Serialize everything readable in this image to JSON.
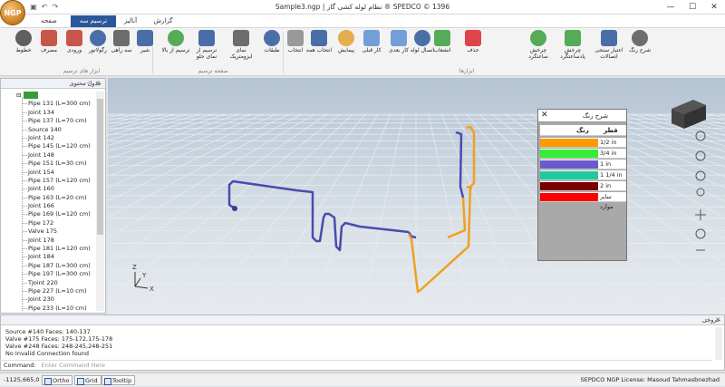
{
  "window": {
    "title": "Sample3.ngp | نظام لوله کشی گاز  ®  SPEDCO  ©  1396",
    "min": "—",
    "max": "☐",
    "close": "✕"
  },
  "tabs": [
    "گزارش",
    "آنالیز",
    "ترسیم سه بعدی",
    "صفحه اصلی"
  ],
  "ribbon": {
    "buttons": [
      {
        "label": "شرح رنگ",
        "icon": "list-icon"
      },
      {
        "label": "اعتبار سنجی اتصالات",
        "icon": "validate-icon"
      },
      {
        "label": "چرخش پادساعتگرد",
        "icon": "rotate-ccw-icon"
      },
      {
        "label": "چرخش ساعتگرد",
        "icon": "rotate-cw-icon"
      },
      {
        "label": "حذف",
        "icon": "delete-icon"
      },
      {
        "label": "انشعاب",
        "icon": "branch-icon"
      },
      {
        "label": "اتصال لوله",
        "icon": "connect-icon"
      },
      {
        "label": "کار بعدی",
        "icon": "redo-icon"
      },
      {
        "label": "کار قبلی",
        "icon": "undo-icon"
      },
      {
        "label": "پیمایش",
        "icon": "pan-icon"
      },
      {
        "label": "انتخاب همه",
        "icon": "select-all-icon"
      },
      {
        "label": "انتخاب",
        "icon": "select-icon"
      },
      {
        "label": "طبقات",
        "icon": "floors-icon"
      },
      {
        "label": "نمای ایزومتریک",
        "icon": "eye-icon"
      },
      {
        "label": "ترسیم از نمای جلو",
        "icon": "front-view-icon"
      },
      {
        "label": "ترسیم از بالا",
        "icon": "top-view-icon"
      },
      {
        "label": "شیر",
        "icon": "valve-icon"
      },
      {
        "label": "سه راهی",
        "icon": "tee-icon"
      },
      {
        "label": "رگولاتور",
        "icon": "regulator-icon"
      },
      {
        "label": "ورودی",
        "icon": "inlet-icon"
      },
      {
        "label": "مصرف",
        "icon": "consumer-icon"
      },
      {
        "label": "خطوط",
        "icon": "lines-icon"
      }
    ],
    "groups": [
      "ابزارها",
      "صفحه ترسیم",
      "ابزار های ترسیم"
    ]
  },
  "tree": {
    "title": "جدول محتوی",
    "root": "ngp",
    "items": [
      "Pipe 131 (L=300 cm)",
      "Joint 134",
      "Pipe 137 (L=70 cm)",
      "Source 140",
      "Joint 142",
      "Pipe 145 (L=120 cm)",
      "Joint 148",
      "Pipe 151 (L=30 cm)",
      "Joint 154",
      "Pipe 157 (L=120 cm)",
      "Joint 160",
      "Pipe 163 (L=20 cm)",
      "Joint 166",
      "Pipe 169 (L=120 cm)",
      "Pipe 172",
      "Valve 175",
      "Joint 178",
      "Pipe 181 (L=120 cm)",
      "Joint 184",
      "Pipe 187 (L=300 cm)",
      "Pipe 197 (L=300 cm)",
      "TJoint 220",
      "Pipe 227 (L=10 cm)",
      "Joint 230",
      "Pipe 233 (L=10 cm)"
    ]
  },
  "axes": {
    "z": "Z",
    "y": "Y",
    "x": "X"
  },
  "color_legend": {
    "title": "شرح رنگ",
    "col_color": "رنگ",
    "col_size": "قطر",
    "rows": [
      {
        "size": "1/2 in",
        "color": "#ff9900"
      },
      {
        "size": "3/4 in",
        "color": "#33ee33"
      },
      {
        "size": "1 in",
        "color": "#6a5acd"
      },
      {
        "size": "1 1/4 in",
        "color": "#20c9a0"
      },
      {
        "size": "2 in",
        "color": "#7a0000"
      },
      {
        "size": "سایر موارد",
        "color": "#ff0000"
      }
    ]
  },
  "output": {
    "title": "خروجی",
    "lines": [
      "Source #140 Faces: 140-137",
      "Valve #175 Faces: 175-172,175-178",
      "Valve #248 Faces: 248-245,248-251",
      "No Invalid Connection found"
    ],
    "cmd_label": "Command:",
    "cmd_placeholder": "Enter Command Here"
  },
  "status": {
    "coords": "-1125,665,0",
    "ortho": "Ortho",
    "grid": "Grid",
    "tooltip": "Tooltip",
    "license": "SEPDCO NGP License:  Masoud Tahmasbnezhad"
  },
  "colors": {
    "pipe_blue": "#4a4ab0",
    "pipe_orange": "#f0a020",
    "accent": "#2b579a"
  }
}
